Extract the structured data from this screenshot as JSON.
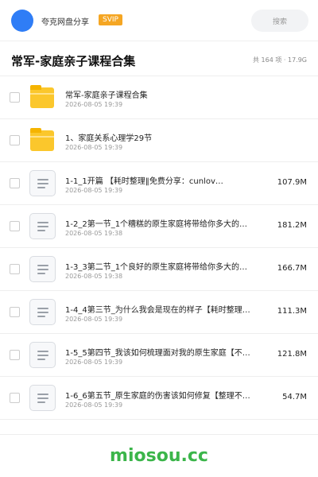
{
  "header": {
    "app_name": "夸克网盘分享",
    "badge": "SVIP",
    "search_placeholder": "搜索"
  },
  "share": {
    "title": "常军-家庭亲子课程合集",
    "summary": "共 164 项 · 17.9G"
  },
  "items": [
    {
      "type": "folder",
      "name": "常军-家庭亲子课程合集",
      "date": "2026-08-05 19:39",
      "size": ""
    },
    {
      "type": "folder",
      "name": "1、家庭关系心理学29节",
      "date": "2026-08-05 19:39",
      "size": ""
    },
    {
      "type": "file",
      "name": "1-1_1开篇 【耗时整理‖免费分享：cunlov…",
      "date": "2026-08-05 19:39",
      "size": "107.9M"
    },
    {
      "type": "file",
      "name": "1-2_2第一节_1个糟糕的原生家庭将带给你多大的…",
      "date": "2026-08-05 19:38",
      "size": "181.2M"
    },
    {
      "type": "file",
      "name": "1-3_3第二节_1个良好的原生家庭将带给你多大的…",
      "date": "2026-08-05 19:38",
      "size": "166.7M"
    },
    {
      "type": "file",
      "name": "1-4_4第三节_为什么我会是现在的样子【耗时整理…",
      "date": "2026-08-05 19:39",
      "size": "111.3M"
    },
    {
      "type": "file",
      "name": "1-5_5第四节_我该如何梳理面对我的原生家庭【不…",
      "date": "2026-08-05 19:39",
      "size": "121.8M"
    },
    {
      "type": "file",
      "name": "1-6_6第五节_原生家庭的伤害该如何修复【整理不…",
      "date": "2026-08-05 19:39",
      "size": "54.7M"
    }
  ],
  "footer": {
    "brand": "miosou.cc"
  },
  "colors": {
    "avatar": "#2f7df6",
    "badge": "#f5a623",
    "folder": "#fbc72c",
    "brand": "#3bb54a"
  },
  "icons": {
    "folder": "folder-icon",
    "file": "document-icon"
  }
}
